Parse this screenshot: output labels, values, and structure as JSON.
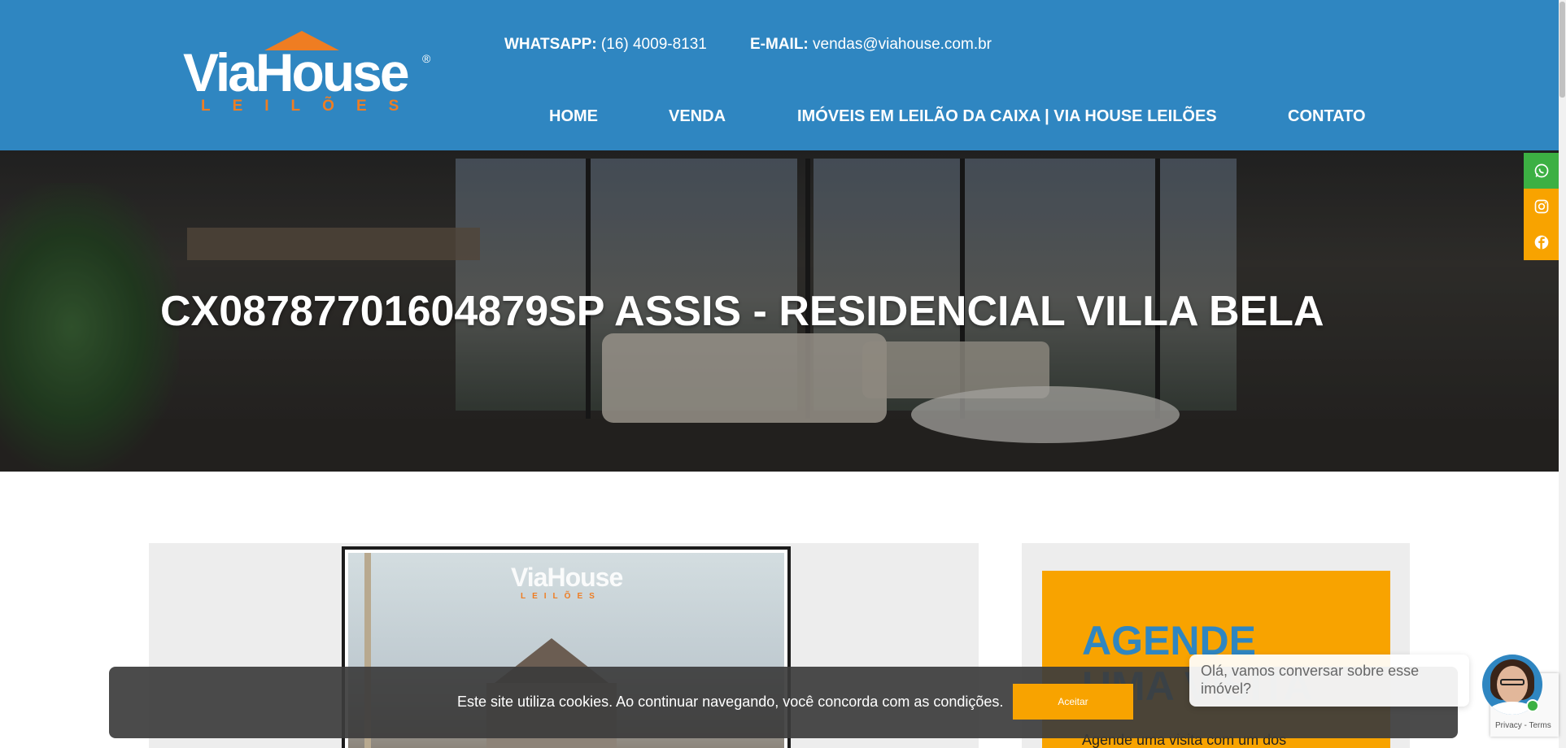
{
  "brand": {
    "logo_text": "ViaHouse",
    "logo_sub": "LEILÕES",
    "logo_reg": "®"
  },
  "contact": {
    "whatsapp_label": "WHATSAPP:",
    "whatsapp_value": "(16) 4009-8131",
    "email_label": "E-MAIL:",
    "email_value": "vendas@viahouse.com.br"
  },
  "nav": {
    "items": [
      {
        "label": "HOME"
      },
      {
        "label": "VENDA"
      },
      {
        "label": "IMÓVEIS EM LEILÃO DA CAIXA | VIA HOUSE LEILÕES"
      },
      {
        "label": "CONTATO"
      }
    ]
  },
  "hero": {
    "title": "CX0878770160487​9SP ASSIS - RESIDENCIAL VILLA BELA"
  },
  "social": {
    "icons": [
      "whatsapp-icon",
      "instagram-icon",
      "facebook-icon"
    ]
  },
  "gallery": {
    "watermark": "ViaHouse",
    "watermark_sub": "LEILÕES"
  },
  "sidebar": {
    "title": "AGENDE UMA VISITA",
    "text": "Agende uma visita com um dos"
  },
  "cookie": {
    "text": "Este site utiliza cookies. Ao continuar navegando, você concorda com as condições.",
    "button": "Aceitar"
  },
  "chat": {
    "message": "Olá, vamos conversar sobre esse imóvel?"
  },
  "recaptcha": {
    "text": "Privacy - Terms"
  },
  "colors": {
    "header_blue": "#2f86c1",
    "accent_orange": "#f8a300",
    "logo_orange": "#ef7d22",
    "whatsapp_green": "#3cb043"
  }
}
